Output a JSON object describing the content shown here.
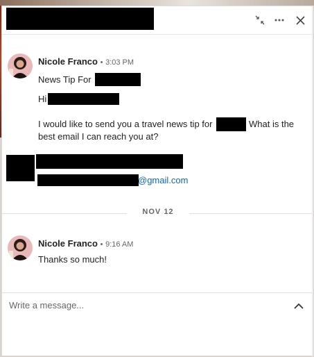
{
  "header": {
    "minimize_icon": "collapse-arrows-icon",
    "more_icon": "more-horizontal-icon",
    "close_icon": "close-icon"
  },
  "messages": [
    {
      "sender": "Nicole Franco",
      "separator": "•",
      "time": "3:03 PM",
      "subject": "News Tip For",
      "greeting": "Hi",
      "body_before": "I would like to send you a travel news tip for",
      "body_after": "What is the best email I can reach you at?",
      "body_second_line": "best email I can reach you at?",
      "email_suffix": "@gmail.com"
    },
    {
      "sender": "Nicole Franco",
      "separator": "•",
      "time": "9:16 AM",
      "text": "Thanks so much!"
    }
  ],
  "date_divider": "NOV 12",
  "composer": {
    "placeholder": "Write a message...",
    "expand_icon": "chevron-up-icon"
  },
  "colors": {
    "link": "#0a66c2",
    "redaction": "#000000"
  }
}
